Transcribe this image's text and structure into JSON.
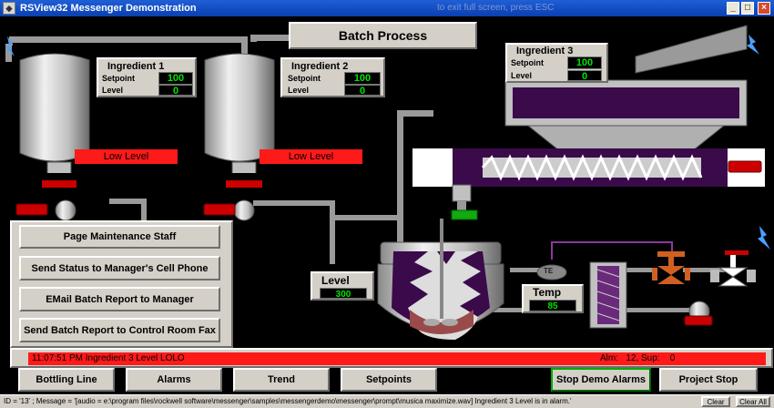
{
  "window": {
    "title": "RSView32 Messenger Demonstration",
    "ghost_text": "to exit full screen, press ESC"
  },
  "header": {
    "title": "Batch Process"
  },
  "ingredients": [
    {
      "name": "Ingredient 1",
      "setpoint_label": "Setpoint",
      "setpoint": "100",
      "level_label": "Level",
      "level": "0",
      "low_level": "Low Level"
    },
    {
      "name": "Ingredient 2",
      "setpoint_label": "Setpoint",
      "setpoint": "100",
      "level_label": "Level",
      "level": "0",
      "low_level": "Low Level"
    },
    {
      "name": "Ingredient 3",
      "setpoint_label": "Setpoint",
      "setpoint": "100",
      "level_label": "Level",
      "level": "0"
    }
  ],
  "reactor": {
    "level_label": "Level",
    "level_value": "300",
    "temp_label": "Temp",
    "temp_value": "85",
    "te_label": "TE"
  },
  "actions": [
    "Page Maintenance Staff",
    "Send Status to Manager's Cell Phone",
    "EMail Batch Report to Manager",
    "Send Batch Report to Control Room Fax"
  ],
  "alarm_banner": {
    "message": "11:07:51 PM Ingredient 3 Level  LOLO",
    "counts": "Alm:   12, Sup:    0"
  },
  "nav": [
    "Bottling Line",
    "Alarms",
    "Trend",
    "Setpoints",
    "Stop Demo Alarms",
    "Project Stop"
  ],
  "statusbar": {
    "message": "ID = '13' ; Message = '[audio = e:\\program files\\rockwell software\\messenger\\samples\\messengerdemo\\messenger\\prompt\\musica maximize.wav]  Ingredient 3 Level is in alarm.'",
    "clear": "Clear",
    "clear_all": "Clear All"
  },
  "colors": {
    "alarm_red": "#ff1a1a",
    "lcd_green": "#00e400",
    "vessel_gray": "#c8c8c8",
    "conveyor_purple": "#3a0a4a",
    "title_blue": "#0a3fb0"
  }
}
